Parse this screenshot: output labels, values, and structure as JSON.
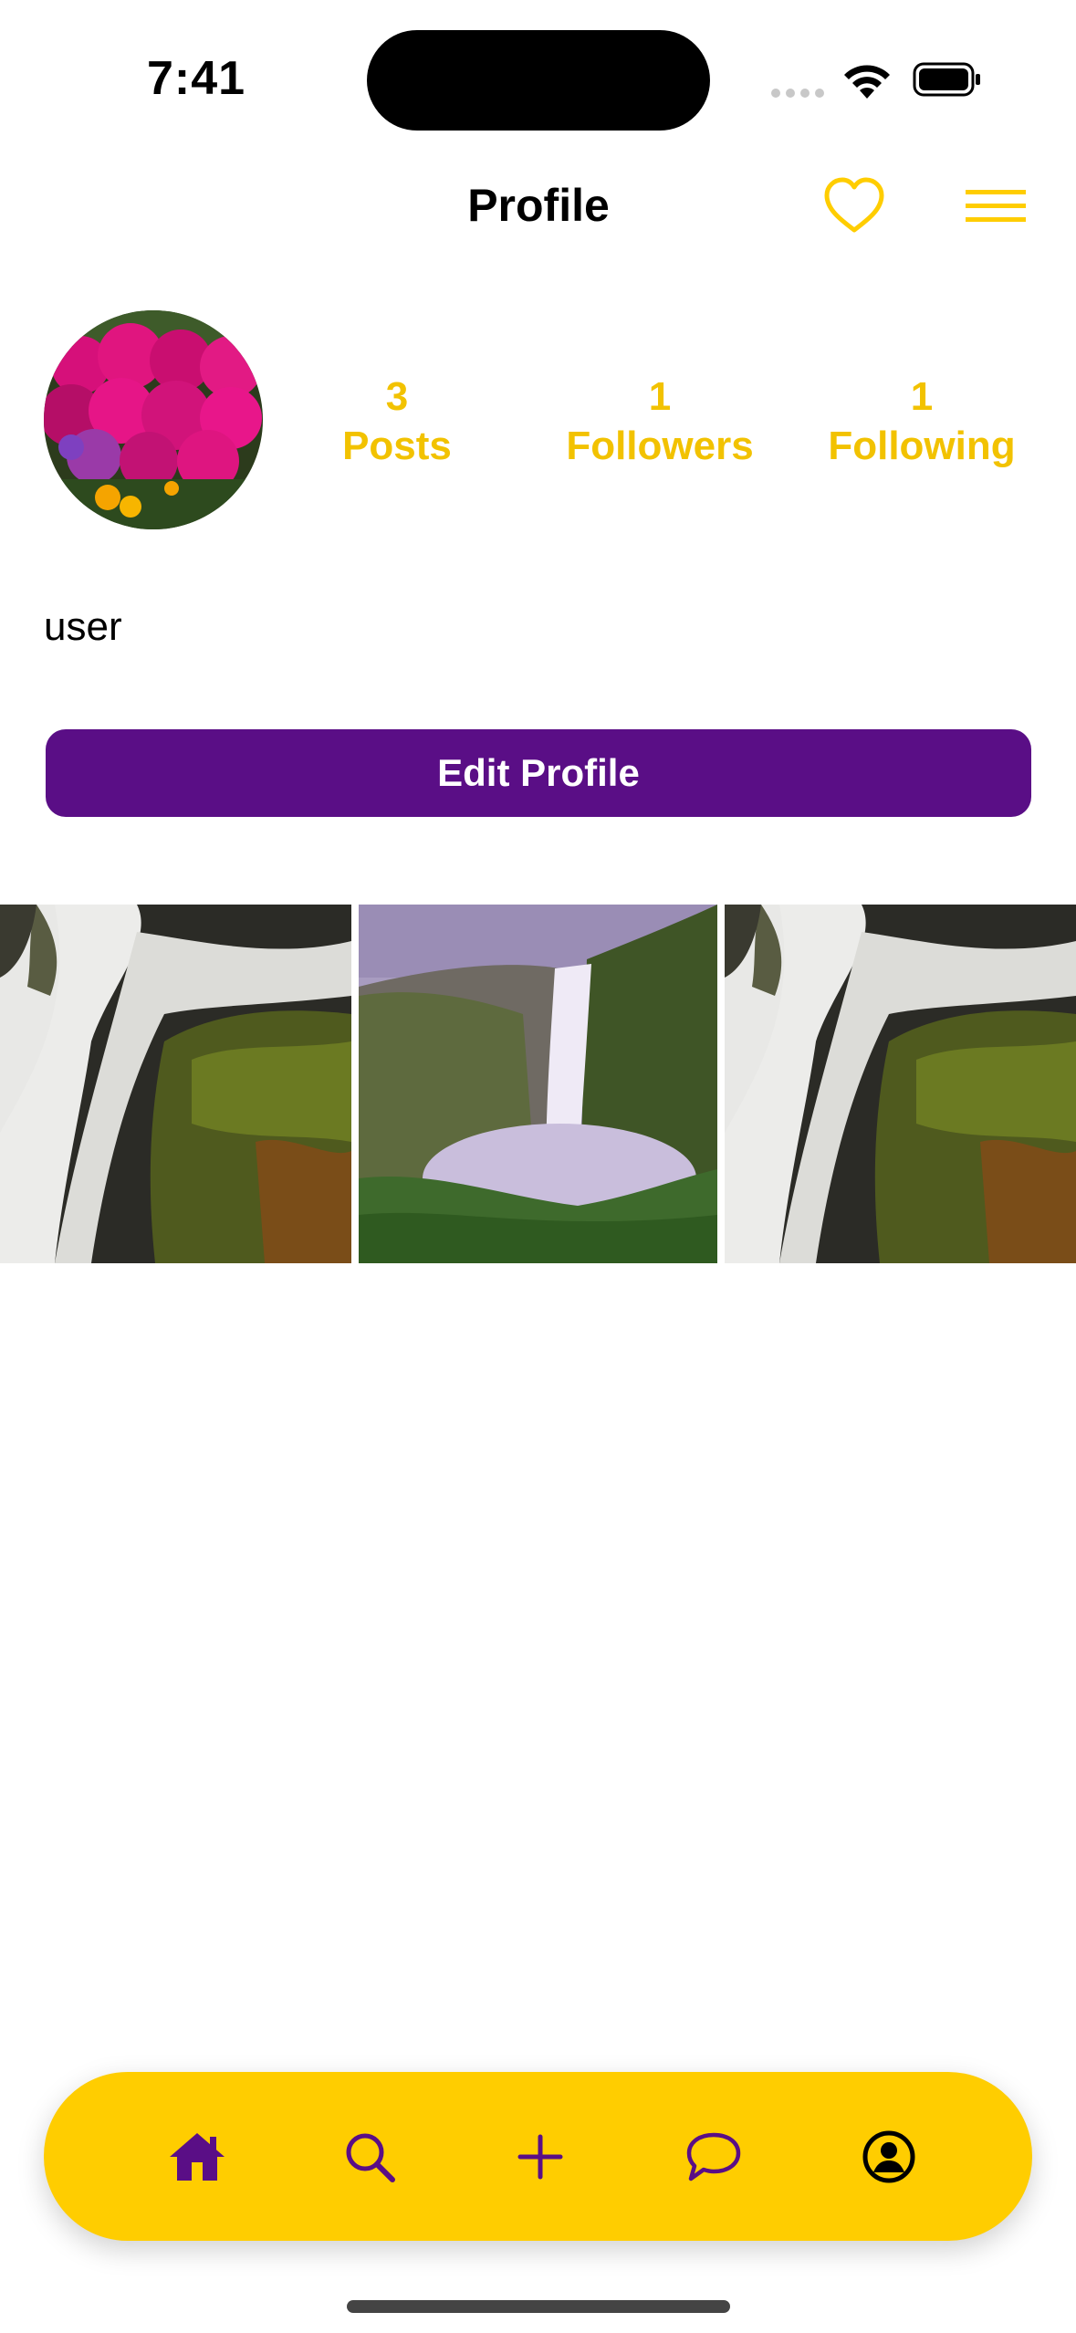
{
  "status_bar": {
    "time": "7:41"
  },
  "nav": {
    "title": "Profile"
  },
  "profile": {
    "username": "user",
    "stats": {
      "posts": {
        "count": "3",
        "label": "Posts"
      },
      "followers": {
        "count": "1",
        "label": "Followers"
      },
      "following": {
        "count": "1",
        "label": "Following"
      }
    },
    "edit_button_label": "Edit Profile"
  },
  "grid": [
    "waterfall rocks photo",
    "waterfall valley photo",
    "waterfall rocks photo"
  ],
  "tab_bar": [
    "home-icon",
    "search-icon",
    "add-icon",
    "chat-icon",
    "profile-icon"
  ],
  "colors": {
    "accent": "#ffcd00",
    "stat_text": "#f2c200",
    "primary": "#5a0e86"
  }
}
